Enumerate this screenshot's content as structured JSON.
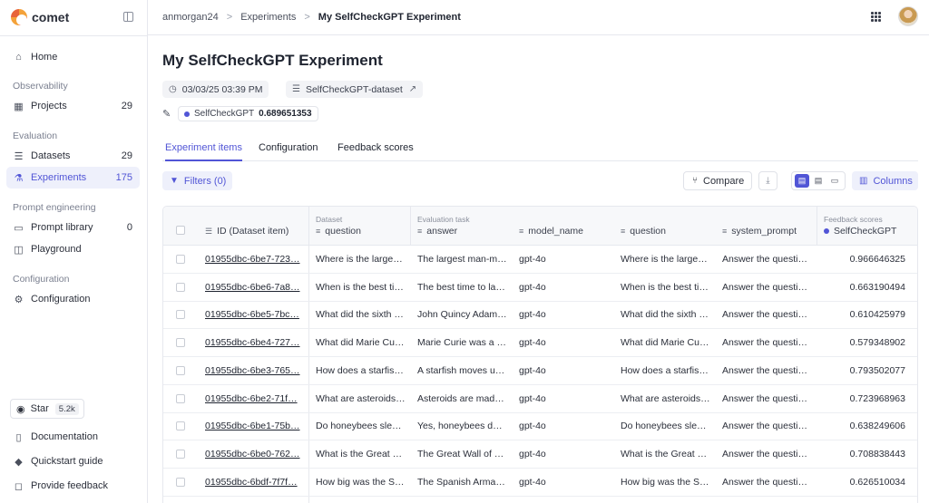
{
  "brand": {
    "name": "comet"
  },
  "sidebar": {
    "home": "Home",
    "observability_label": "Observability",
    "projects": {
      "label": "Projects",
      "count": "29"
    },
    "evaluation_label": "Evaluation",
    "datasets": {
      "label": "Datasets",
      "count": "29"
    },
    "experiments": {
      "label": "Experiments",
      "count": "175"
    },
    "prompt_label": "Prompt engineering",
    "prompt_library": {
      "label": "Prompt library",
      "count": "0"
    },
    "playground": "Playground",
    "configuration_label": "Configuration",
    "configuration": "Configuration",
    "star": {
      "label": "Star",
      "count": "5.2k"
    },
    "documentation": "Documentation",
    "quickstart": "Quickstart guide",
    "feedback": "Provide feedback"
  },
  "breadcrumb": {
    "workspace": "anmorgan24",
    "section": "Experiments",
    "current": "My SelfCheckGPT Experiment",
    "separator": ">"
  },
  "page": {
    "title": "My SelfCheckGPT Experiment",
    "date": "03/03/25 03:39 PM",
    "dataset": "SelfCheckGPT-dataset",
    "score_name": "SelfCheckGPT",
    "score_value": "0.689651353"
  },
  "tabs": [
    "Experiment items",
    "Configuration",
    "Feedback scores"
  ],
  "toolbar": {
    "filters": "Filters (0)",
    "compare": "Compare",
    "columns": "Columns"
  },
  "table": {
    "groups": {
      "dataset": "Dataset",
      "evaluation": "Evaluation task",
      "feedback": "Feedback scores"
    },
    "headers": [
      "ID (Dataset item)",
      "question",
      "answer",
      "model_name",
      "question",
      "system_prompt",
      "SelfCheckGPT"
    ],
    "rows": [
      [
        "01955dbc-6be7-723…",
        "Where is the large…",
        "The largest man-m…",
        "gpt-4o",
        "Where is the large…",
        "Answer the questi…",
        "0.966646325"
      ],
      [
        "01955dbc-6be6-7a8…",
        "When is the best ti…",
        "The best time to la…",
        "gpt-4o",
        "When is the best ti…",
        "Answer the questi…",
        "0.663190494"
      ],
      [
        "01955dbc-6be5-7bc…",
        "What did the sixth …",
        "John Quincy Adam…",
        "gpt-4o",
        "What did the sixth …",
        "Answer the questi…",
        "0.610425979"
      ],
      [
        "01955dbc-6be4-727…",
        "What did Marie Cu…",
        "Marie Curie was a …",
        "gpt-4o",
        "What did Marie Cu…",
        "Answer the questi…",
        "0.579348902"
      ],
      [
        "01955dbc-6be3-765…",
        "How does a starfis…",
        "A starfish moves u…",
        "gpt-4o",
        "How does a starfis…",
        "Answer the questi…",
        "0.793502077"
      ],
      [
        "01955dbc-6be2-71f…",
        "What are asteroids…",
        "Asteroids are mad…",
        "gpt-4o",
        "What are asteroids…",
        "Answer the questi…",
        "0.723968963"
      ],
      [
        "01955dbc-6be1-75b…",
        "Do honeybees sle…",
        "Yes, honeybees d…",
        "gpt-4o",
        "Do honeybees sle…",
        "Answer the questi…",
        "0.638249606"
      ],
      [
        "01955dbc-6be0-762…",
        "What is the Great …",
        "The Great Wall of …",
        "gpt-4o",
        "What is the Great …",
        "Answer the questi…",
        "0.708838443"
      ],
      [
        "01955dbc-6bdf-7f7f…",
        "How big was the S…",
        "The Spanish Arma…",
        "gpt-4o",
        "How big was the S…",
        "Answer the questi…",
        "0.626510034"
      ]
    ]
  },
  "colors": {
    "accent": "#5155d6",
    "accent_bg": "#eef0fb"
  }
}
